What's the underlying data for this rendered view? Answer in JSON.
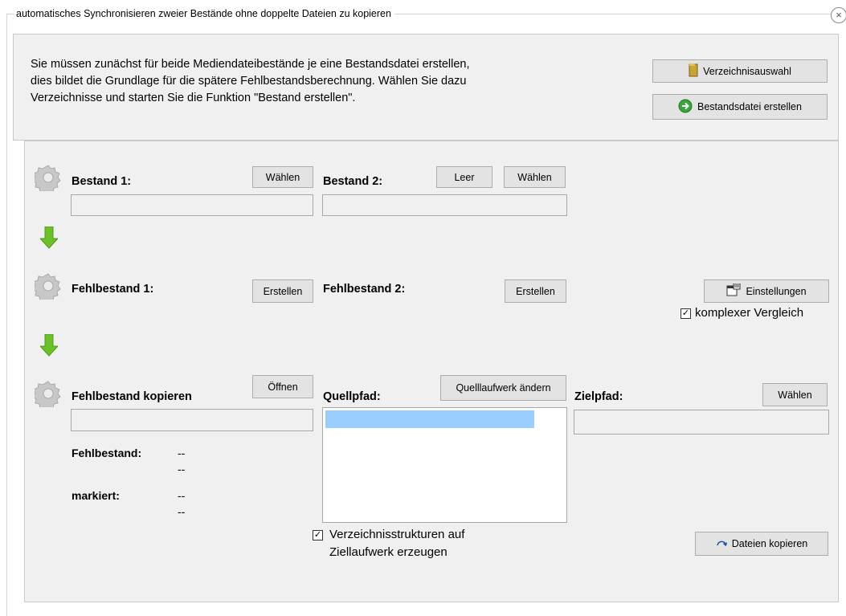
{
  "window": {
    "title": "automatisches Synchronisieren zweier Bestände ohne doppelte Dateien zu kopieren",
    "close_glyph": "×"
  },
  "intro": {
    "lines": [
      "Sie müssen zunächst für beide Mediendateibestände je eine Bestandsdatei erstellen,",
      "dies bildet die Grundlage für die spätere Fehlbestandsberechnung. Wählen Sie dazu",
      "Verzeichnisse und starten Sie die Funktion \"Bestand erstellen\"."
    ],
    "buttons": {
      "directory_select": "Verzeichnisauswahl",
      "create_inventory_file": "Bestandsdatei erstellen"
    }
  },
  "bestand1": {
    "label": "Bestand 1:",
    "choose": "Wählen",
    "value": ""
  },
  "bestand2": {
    "label": "Bestand 2:",
    "empty": "Leer",
    "choose": "Wählen",
    "value": ""
  },
  "fehlbestand1": {
    "label": "Fehlbestand 1:",
    "create": "Erstellen"
  },
  "fehlbestand2": {
    "label": "Fehlbestand 2:",
    "create": "Erstellen"
  },
  "settings": {
    "button": "Einstellungen",
    "complex_compare": "komplexer Vergleich",
    "complex_compare_checked": true
  },
  "copy": {
    "label": "Fehlbestand kopieren",
    "open": "Öffnen",
    "value": "",
    "missing_label": "Fehlbestand:",
    "missing_value_1": "--",
    "missing_value_2": "--",
    "marked_label": "markiert:",
    "marked_value_1": "--",
    "marked_value_2": "--"
  },
  "source": {
    "label": "Quellpfad:",
    "change_drive": "Quelllaufwerk ändern",
    "selected_highlight_color": "#99ccff",
    "create_structure_line1": "Verzeichnisstrukturen auf",
    "create_structure_line2": "Ziellaufwerk erzeugen",
    "create_structure_checked": true
  },
  "target": {
    "label": "Zielpfad:",
    "choose": "Wählen",
    "value": ""
  },
  "copy_files_button": "Dateien kopieren",
  "colors": {
    "panel_bg": "#f0f0f0",
    "arrow_green": "#6cc02a",
    "button_bg": "#e3e3e3"
  },
  "icons": [
    "gear-icon",
    "down-arrow-icon",
    "folder-icon",
    "green-arrow-circle-icon",
    "settings-dialog-icon",
    "refresh-icon",
    "checkbox-icon"
  ]
}
